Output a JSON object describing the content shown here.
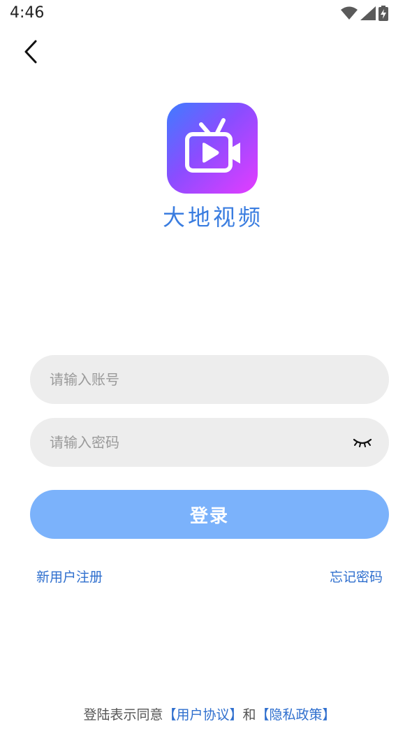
{
  "status_bar": {
    "time": "4:46",
    "icons": [
      "wifi-icon",
      "signal-icon",
      "battery-charging-icon"
    ]
  },
  "header": {
    "back_icon": "chevron-left-icon"
  },
  "brand": {
    "logo_icon": "tv-play-icon",
    "app_name": "大地视频",
    "colors": {
      "logo_gradient_start": "#3f7cff",
      "logo_gradient_end": "#e43cff",
      "app_name": "#3a7de0"
    }
  },
  "form": {
    "account_placeholder": "请输入账号",
    "password_placeholder": "请输入密码",
    "password_toggle_icon": "eye-closed-icon",
    "login_label": "登录",
    "login_color": "#7bb2fb"
  },
  "links": {
    "register": "新用户注册",
    "forgot_password": "忘记密码"
  },
  "agreement": {
    "prefix": "登陆表示同意",
    "user_agreement": "【用户协议】",
    "conjunction": "和",
    "privacy_policy": "【隐私政策】"
  }
}
